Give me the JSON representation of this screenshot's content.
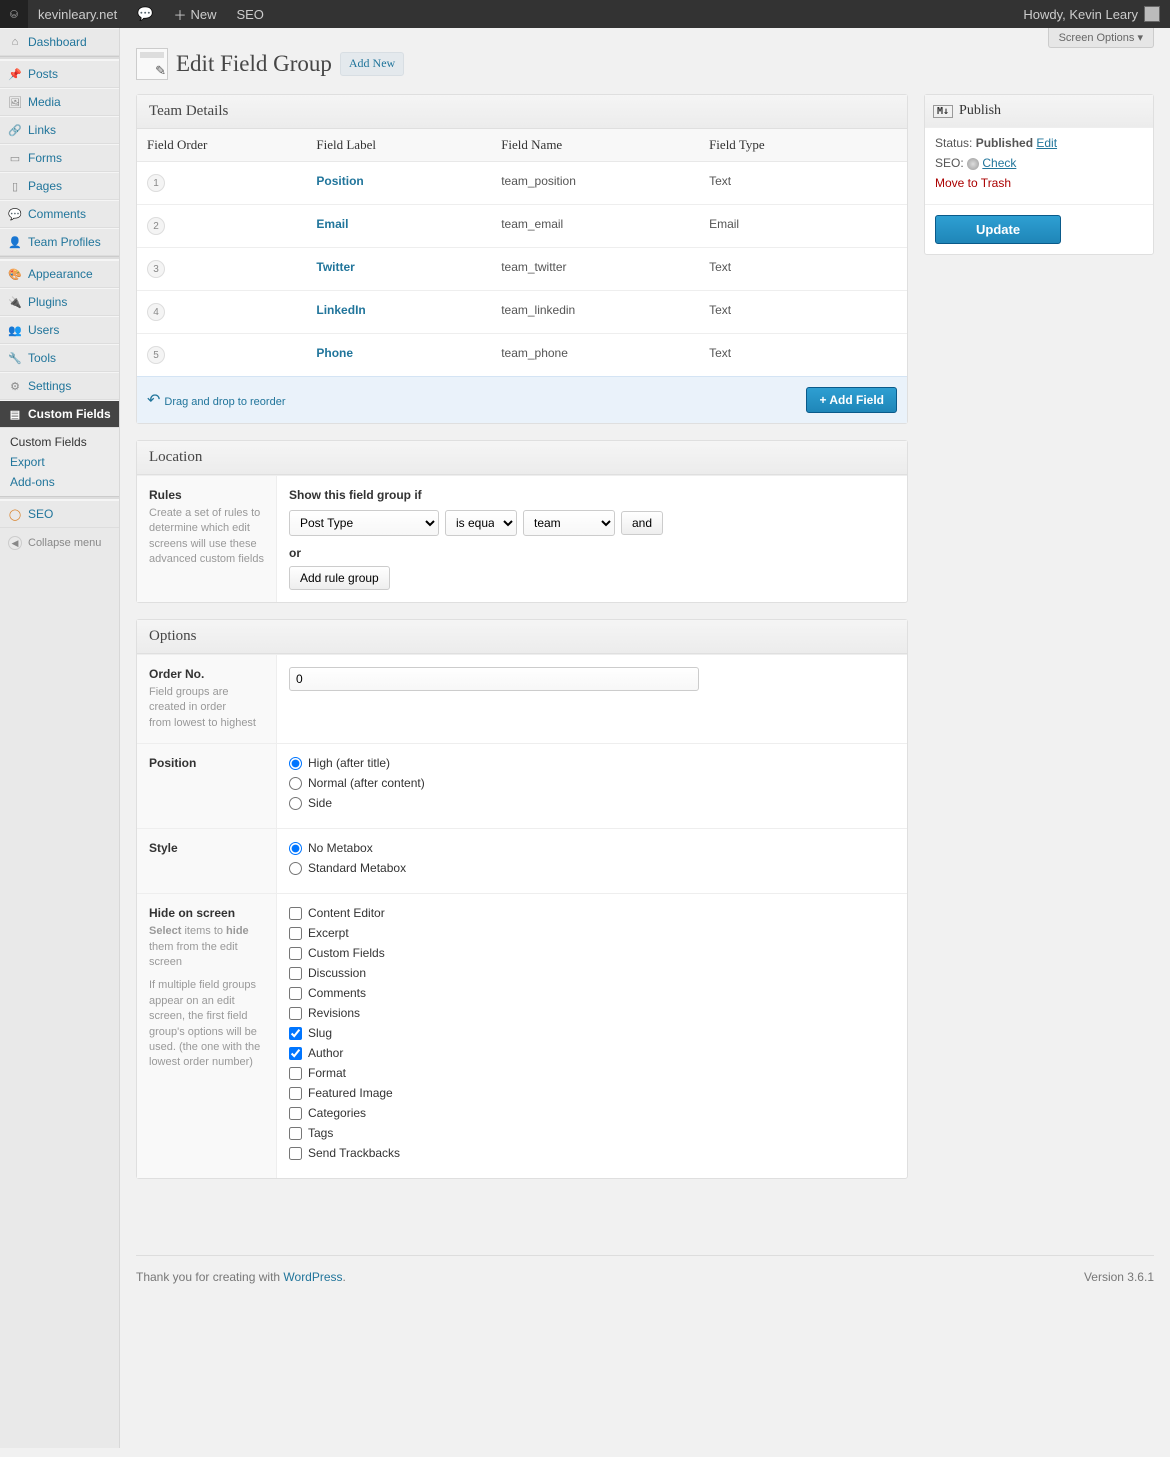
{
  "adminbar": {
    "site": "kevinleary.net",
    "new": "New",
    "seo": "SEO",
    "howdy": "Howdy, Kevin Leary"
  },
  "sidebar": {
    "items": [
      {
        "label": "Dashboard",
        "icon": "⌂"
      },
      {
        "label": "Posts",
        "icon": "📌"
      },
      {
        "label": "Media",
        "icon": "🖼"
      },
      {
        "label": "Links",
        "icon": "🔗"
      },
      {
        "label": "Forms",
        "icon": "▭"
      },
      {
        "label": "Pages",
        "icon": "▯"
      },
      {
        "label": "Comments",
        "icon": "💬"
      },
      {
        "label": "Team Profiles",
        "icon": "👤"
      },
      {
        "label": "Appearance",
        "icon": "🎨"
      },
      {
        "label": "Plugins",
        "icon": "🔌"
      },
      {
        "label": "Users",
        "icon": "👥"
      },
      {
        "label": "Tools",
        "icon": "🔧"
      },
      {
        "label": "Settings",
        "icon": "⚙"
      },
      {
        "label": "Custom Fields",
        "icon": "▤"
      },
      {
        "label": "SEO",
        "icon": "◯"
      }
    ],
    "submenu": {
      "customfields": "Custom Fields",
      "export": "Export",
      "addons": "Add-ons"
    },
    "collapse": "Collapse menu"
  },
  "screen_options": "Screen Options ▾",
  "page": {
    "title": "Edit Field Group",
    "add_new": "Add New"
  },
  "team_box": {
    "title": "Team Details",
    "headers": {
      "order": "Field Order",
      "label": "Field Label",
      "name": "Field Name",
      "type": "Field Type"
    },
    "rows": [
      {
        "order": "1",
        "label": "Position",
        "name": "team_position",
        "type": "Text"
      },
      {
        "order": "2",
        "label": "Email",
        "name": "team_email",
        "type": "Email"
      },
      {
        "order": "3",
        "label": "Twitter",
        "name": "team_twitter",
        "type": "Text"
      },
      {
        "order": "4",
        "label": "LinkedIn",
        "name": "team_linkedin",
        "type": "Text"
      },
      {
        "order": "5",
        "label": "Phone",
        "name": "team_phone",
        "type": "Text"
      }
    ],
    "drag_hint": "Drag and drop to reorder",
    "add_field": "+ Add Field"
  },
  "location": {
    "title": "Location",
    "rules_label": "Rules",
    "rules_desc": "Create a set of rules to determine which edit screens will use these advanced custom fields",
    "show_if": "Show this field group if",
    "param": "Post Type",
    "operator": "is equal to",
    "value": "team",
    "and": "and",
    "or": "or",
    "add_group": "Add rule group"
  },
  "options": {
    "title": "Options",
    "order_label": "Order No.",
    "order_desc1": "Field groups are created in order",
    "order_desc2": "from lowest to highest",
    "order_value": "0",
    "position_label": "Position",
    "position": {
      "high": "High (after title)",
      "normal": "Normal (after content)",
      "side": "Side",
      "selected": "high"
    },
    "style_label": "Style",
    "style": {
      "none": "No Metabox",
      "standard": "Standard Metabox",
      "selected": "none"
    },
    "hide_label": "Hide on screen",
    "hide_desc1a": "Select",
    "hide_desc1b": " items to ",
    "hide_desc1c": "hide",
    "hide_desc1d": " them from the edit screen",
    "hide_desc2": "If multiple field groups appear on an edit screen, the first field group's options will be used. (the one with the lowest order number)",
    "hide_items": [
      {
        "label": "Content Editor",
        "checked": false
      },
      {
        "label": "Excerpt",
        "checked": false
      },
      {
        "label": "Custom Fields",
        "checked": false
      },
      {
        "label": "Discussion",
        "checked": false
      },
      {
        "label": "Comments",
        "checked": false
      },
      {
        "label": "Revisions",
        "checked": false
      },
      {
        "label": "Slug",
        "checked": true
      },
      {
        "label": "Author",
        "checked": true
      },
      {
        "label": "Format",
        "checked": false
      },
      {
        "label": "Featured Image",
        "checked": false
      },
      {
        "label": "Categories",
        "checked": false
      },
      {
        "label": "Tags",
        "checked": false
      },
      {
        "label": "Send Trackbacks",
        "checked": false
      }
    ]
  },
  "publish": {
    "title": "Publish",
    "status_label": "Status: ",
    "status_value": "Published",
    "edit": "Edit",
    "seo_label": "SEO: ",
    "check": "Check",
    "trash": "Move to Trash",
    "update": "Update"
  },
  "footer": {
    "thank1": "Thank you for creating with ",
    "wp": "WordPress",
    "version": "Version 3.6.1"
  }
}
